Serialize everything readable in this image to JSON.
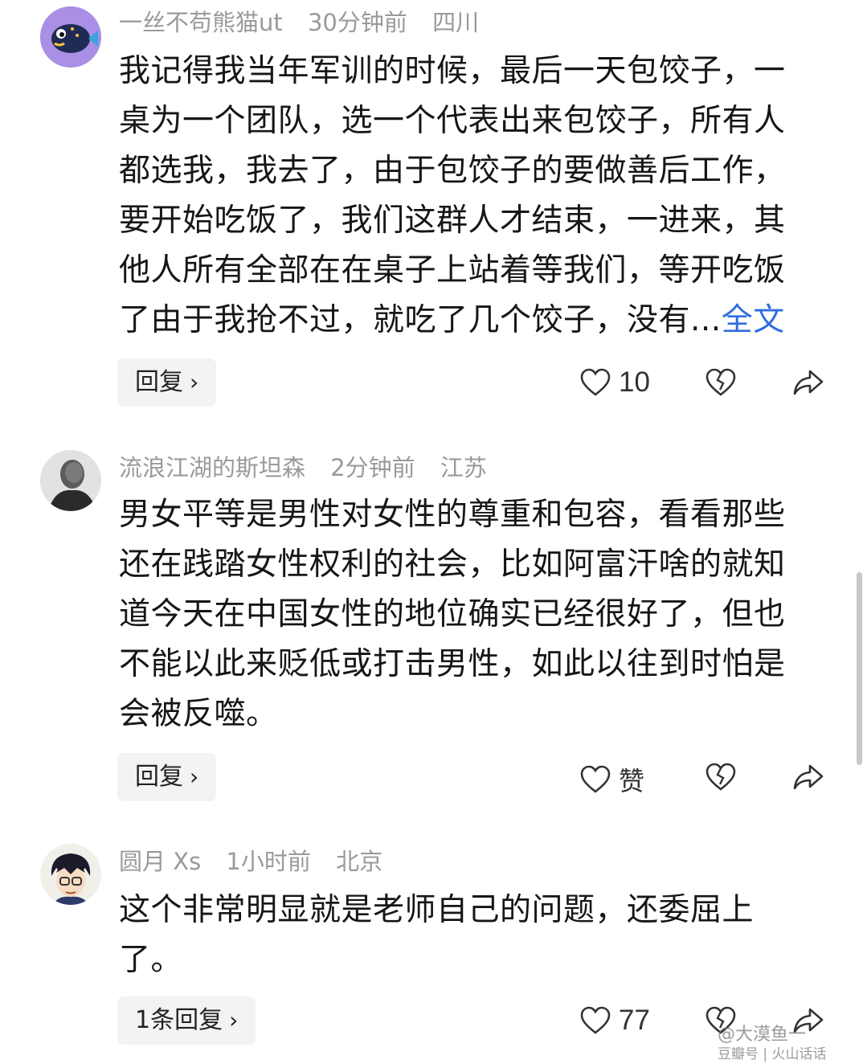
{
  "comments": [
    {
      "username": "一丝不苟熊猫ut",
      "time": "30分钟前",
      "location": "四川",
      "lines": [
        "我记得我当年军训的时候，最后一天包饺子，一",
        "桌为一个团队，选一个代表出来包饺子，所有人",
        "都选我，我去了，由于包饺子的要做善后工作，",
        "要开始吃饭了，我们这群人才结束，一进来，其",
        "他人所有全部在在桌子上站着等我们，等开吃饭",
        "了由于我抢不过，就吃了几个饺子，没有..."
      ],
      "full_text_link": "全文",
      "reply_label": "回复",
      "likes": "10",
      "avatar_icon": "pufferfish-avatar"
    },
    {
      "username": "流浪江湖的斯坦森",
      "time": "2分钟前",
      "location": "江苏",
      "lines": [
        "男女平等是男性对女性的尊重和包容，看看那些",
        "还在践踏女性权利的社会，比如阿富汗啥的就知",
        "道今天在中国女性的地位确实已经很好了，但也",
        "不能以此来贬低或打击男性，如此以往到时怕是",
        "会被反噬。"
      ],
      "reply_label": "回复",
      "likes": "赞",
      "avatar_icon": "man-photo-avatar"
    },
    {
      "username": "圆月 Xs",
      "time": "1小时前",
      "location": "北京",
      "lines": [
        "这个非常明显就是老师自己的问题，还委屈上",
        "了。"
      ],
      "reply_label": "1条回复",
      "likes": "77",
      "avatar_icon": "anime-boy-avatar"
    }
  ],
  "watermark": {
    "line1": "@大漠鱼一",
    "line2": "豆瓣号 | 火山话话"
  },
  "colors": {
    "link": "#2f6ee0",
    "meta": "#9a9a9a",
    "reply_bg": "#f3f3f3"
  }
}
